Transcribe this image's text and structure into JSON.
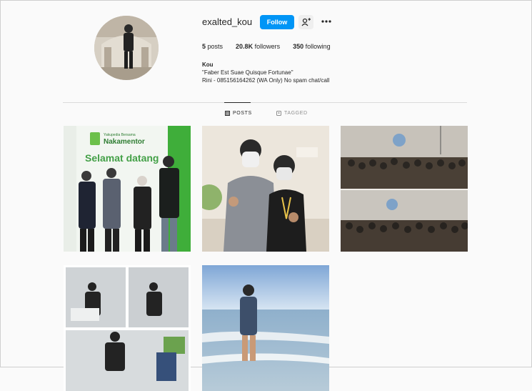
{
  "profile": {
    "username": "exalted_kou",
    "follow_label": "Follow",
    "name": "Kou",
    "bio_line1": "\"Faber Est Suae Quisque Fortunae\"",
    "bio_line2": "Rini - 085156164262 (WA Only) No spam chat/call"
  },
  "stats": {
    "posts_count": "5",
    "posts_label": "posts",
    "followers_count": "20.8K",
    "followers_label": "followers",
    "following_count": "350",
    "following_label": "following"
  },
  "tabs": {
    "posts": "POSTS",
    "tagged": "TAGGED"
  },
  "posts": {
    "p1": {
      "sign_small": "Yakupedia Bersama",
      "sign_brand": "Nakamentor",
      "welcome": "Selamat datang"
    }
  },
  "colors": {
    "accent": "#0095f6",
    "brand_green": "#4caf50"
  },
  "icons": [
    "person-add-icon",
    "more-options-icon",
    "grid-icon",
    "tag-icon"
  ]
}
